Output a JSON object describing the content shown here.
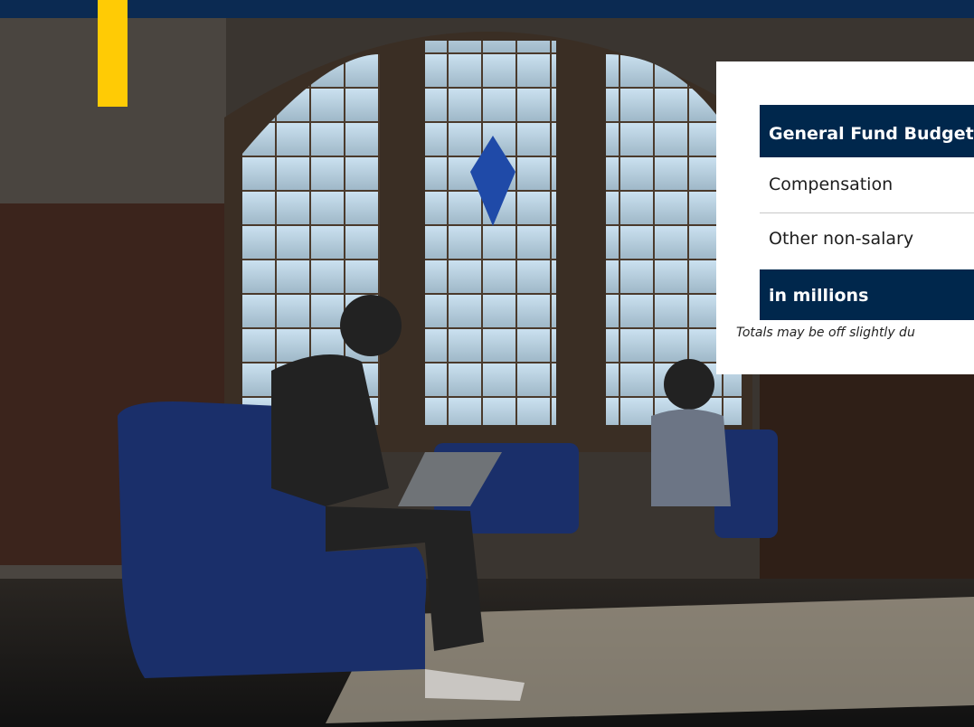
{
  "budget_table": {
    "header_label": "General Fund Budget",
    "rows": [
      {
        "label": "Compensation"
      },
      {
        "label": "Other non-salary"
      }
    ],
    "units_label": "in millions",
    "footnote": "Totals may be off slightly du"
  },
  "colors": {
    "navy": "#00274c",
    "maize": "#ffcb05",
    "top_bar": "#0b2a52"
  }
}
